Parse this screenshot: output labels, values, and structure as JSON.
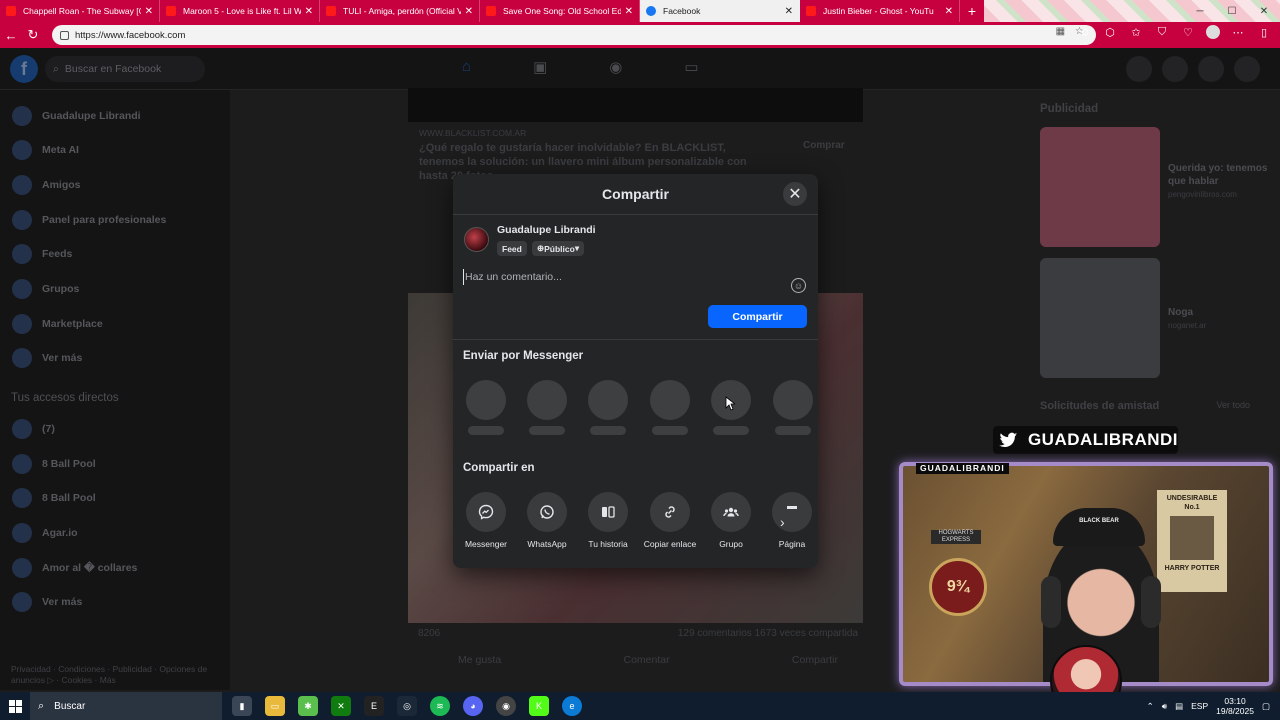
{
  "browser": {
    "tabs": [
      {
        "title": "Chappell Roan - The Subway [Offi",
        "icon": "youtube-icon",
        "active": false
      },
      {
        "title": "Maroon 5 - Love is Like ft. Lil Wa",
        "icon": "youtube-icon",
        "active": false
      },
      {
        "title": "TULI - Amiga, perdón (Official Vi",
        "icon": "youtube-icon",
        "active": false
      },
      {
        "title": "Save One Song: Old School Editi",
        "icon": "youtube-icon",
        "active": false
      },
      {
        "title": "Facebook",
        "icon": "facebook-icon",
        "active": true
      },
      {
        "title": "Justin Bieber - Ghost - YouTu",
        "icon": "youtube-icon",
        "active": false
      }
    ],
    "url": "https://www.facebook.com",
    "accent": "#c7003f"
  },
  "facebook": {
    "search_placeholder": "Buscar en Facebook",
    "sidebar": {
      "items": [
        "Guadalupe Librandi",
        "Meta AI",
        "Amigos",
        "Panel para profesionales",
        "Feeds",
        "Grupos",
        "Marketplace",
        "Ver más"
      ],
      "shortcuts_title": "Tus accesos directos",
      "shortcuts": [
        "(7)",
        "8 Ball Pool",
        "8 Ball Pool",
        "Agar.io",
        "Amor al � collares",
        "Ver más"
      ],
      "footer": "Privacidad · Condiciones · Publicidad · Opciones de anuncios ▷ · Cookies · Más"
    },
    "feed": {
      "ad_url": "WWW.BLACKLIST.COM.AR",
      "ad_text": "¿Qué regalo te gustaría hacer inolvidable? En BLACKLIST, tenemos la solución: un llavero mini álbum personalizable con hasta 20 fotos...",
      "ad_button": "Comprar",
      "reactions": "8206",
      "comments": "129 comentarios",
      "shares": "1673 veces compartida",
      "actions": [
        "Me gusta",
        "Comentar",
        "Compartir"
      ]
    },
    "right": {
      "ads_title": "Publicidad",
      "ad1_title": "Querida yo: tenemos que hablar",
      "ad1_site": "pengovinlibros.com",
      "ad2_title": "Noga",
      "ad2_site": "noganet.ar",
      "requests_title": "Solicitudes de amistad",
      "requests_link": "Ver todo"
    }
  },
  "share_modal": {
    "title": "Compartir",
    "user_name": "Guadalupe Librandi",
    "feed_label": "Feed",
    "audience_label": "Público",
    "comment_placeholder": "Haz un comentario...",
    "share_button": "Compartir",
    "messenger_title": "Enviar por Messenger",
    "share_in_title": "Compartir en",
    "targets": [
      {
        "label": "Messenger",
        "icon": "messenger-icon"
      },
      {
        "label": "WhatsApp",
        "icon": "whatsapp-icon"
      },
      {
        "label": "Tu historia",
        "icon": "story-icon"
      },
      {
        "label": "Copiar enlace",
        "icon": "link-icon"
      },
      {
        "label": "Grupo",
        "icon": "group-icon"
      },
      {
        "label": "Página",
        "icon": "page-icon"
      }
    ],
    "primary_color": "#0866ff"
  },
  "stream": {
    "twitter_handle": "GUADALIBRANDI",
    "cam_label": "GUADALIBRANDI",
    "poster_title": "UNDESIRABLE",
    "poster_sub": "No.1",
    "poster_name": "HARRY POTTER",
    "platform_sign": "HOGWARTS EXPRESS",
    "platform_number": "9¾",
    "cap_text": "BLACK BEAR",
    "frame_color": "#a58bc7"
  },
  "taskbar": {
    "search_label": "Buscar",
    "lang": "ESP",
    "time": "03:10",
    "date": "19/8/2025"
  }
}
